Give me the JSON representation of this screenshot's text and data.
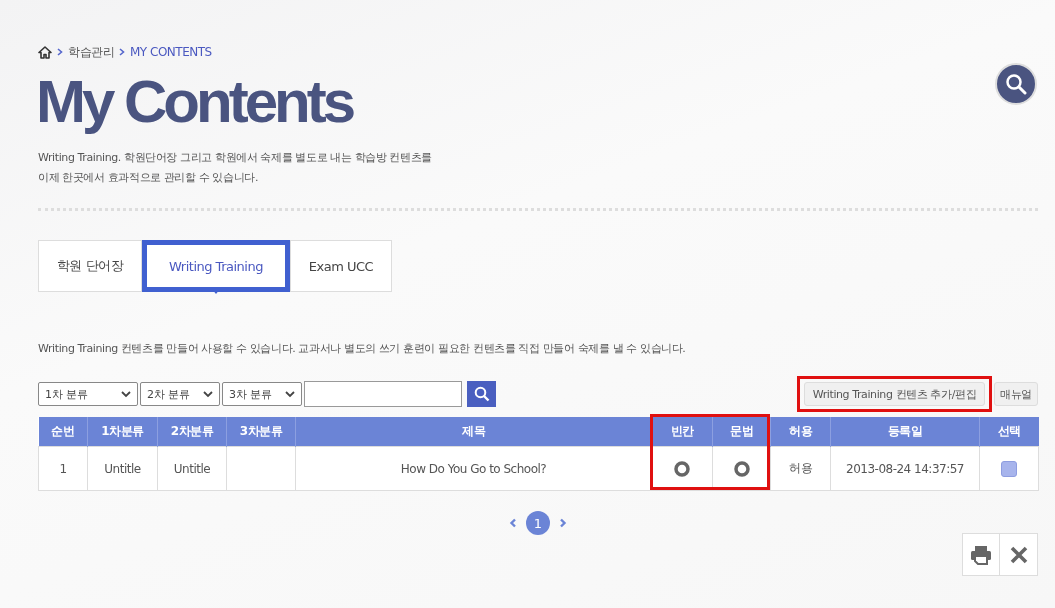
{
  "breadcrumb": {
    "items": [
      "학습관리",
      "MY CONTENTS"
    ]
  },
  "title": "My Contents",
  "description": [
    "Writing Training. 학원단어장 그리고 학원에서 숙제를 별도로 내는 학습방 컨텐츠를",
    "이제 한곳에서 효과적으로 관리할 수 있습니다."
  ],
  "tabs": [
    {
      "label": "학원 단어장",
      "selected": false
    },
    {
      "label": "Writing Training",
      "selected": true
    },
    {
      "label": "Exam UCC",
      "selected": false
    }
  ],
  "tab_description": "Writing Training 컨텐츠를 만들어 사용할 수 있습니다. 교과서나 별도의 쓰기 훈련이 필요한 컨텐츠를 직접 만들어 숙제를 낼 수 있습니다.",
  "filters": [
    {
      "value": "1차 분류"
    },
    {
      "value": "2차 분류"
    },
    {
      "value": "3차 분류"
    }
  ],
  "buttons": {
    "add": "Writing Training 컨텐츠 추가/편집",
    "manual": "매뉴얼"
  },
  "table": {
    "columns": [
      "순번",
      "1차분류",
      "2차분류",
      "3차분류",
      "제목",
      "빈칸",
      "문법",
      "허용",
      "등록일",
      "선택"
    ],
    "rows": [
      {
        "cells": [
          {
            "kind": "text",
            "text": "1"
          },
          {
            "kind": "text",
            "text": "Untitle"
          },
          {
            "kind": "text",
            "text": "Untitle"
          },
          {
            "kind": "text",
            "text": ""
          },
          {
            "kind": "text",
            "text": "How Do You Go to School?"
          },
          {
            "kind": "radio",
            "on": true
          },
          {
            "kind": "radio",
            "on": true
          },
          {
            "kind": "text",
            "text": "허용"
          },
          {
            "kind": "text",
            "text": "2013-08-24 14:37:57"
          },
          {
            "kind": "checkbox",
            "checked": false
          }
        ]
      }
    ]
  },
  "pagination": {
    "pages": [
      {
        "label": "1",
        "selected": true
      }
    ]
  }
}
